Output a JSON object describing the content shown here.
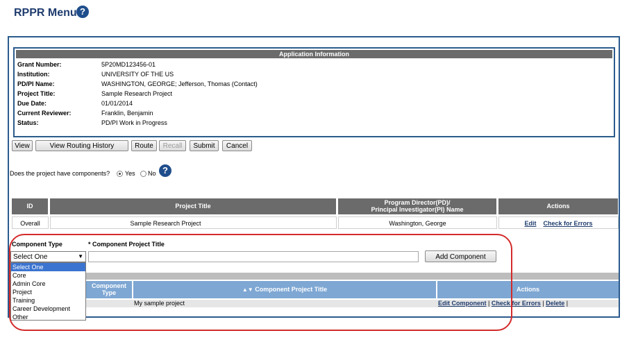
{
  "page": {
    "title": "RPPR Menu"
  },
  "app_info": {
    "header": "Application Information",
    "fields": [
      {
        "label": "Grant Number:",
        "value": "5P20MD123456-01"
      },
      {
        "label": "Institution:",
        "value": "UNIVERSITY OF THE US"
      },
      {
        "label": "PD/PI Name:",
        "value": "WASHINGTON, GEORGE; Jefferson, Thomas (Contact)"
      },
      {
        "label": "Project Title:",
        "value": "Sample Research Project"
      },
      {
        "label": "Due Date:",
        "value": "01/01/2014"
      },
      {
        "label": "Current Reviewer:",
        "value": "Franklin, Benjamin"
      },
      {
        "label": "Status:",
        "value": "PD/PI Work in Progress"
      }
    ]
  },
  "buttons": {
    "view": "View",
    "routing_history": "View Routing History",
    "route": "Route",
    "recall": "Recall",
    "submit": "Submit",
    "cancel": "Cancel"
  },
  "components_question": {
    "text": "Does the project have components?",
    "yes": "Yes",
    "no": "No",
    "selected": "Yes"
  },
  "project_table": {
    "headers": {
      "id": "ID",
      "title": "Project Title",
      "pd_line1": "Program Director(PD)/",
      "pd_line2": "Principal Investigator(PI) Name",
      "actions": "Actions"
    },
    "row": {
      "id": "Overall",
      "title": "Sample Research Project",
      "pd": "Washington, George",
      "edit": "Edit",
      "check": "Check for Errors"
    }
  },
  "add_component": {
    "type_label": "Component Type",
    "title_label": "* Component Project Title",
    "select_value": "Select One",
    "title_value": "",
    "add_button": "Add Component",
    "options": [
      "Select One",
      "Core",
      "Admin Core",
      "Project",
      "Training",
      "Career Development",
      "Other"
    ]
  },
  "component_table": {
    "headers": {
      "type": "Component Type",
      "title": "Component Project Title",
      "actions": "Actions"
    },
    "row": {
      "title": "My sample project",
      "edit": "Edit Component",
      "check": "Check for Errors",
      "delete": "Delete"
    }
  },
  "colors": {
    "accent": "#1f3c6e",
    "header_gray": "#6b6b6b",
    "header_blue": "#7ea7d3",
    "highlight": "#d42a2a"
  }
}
